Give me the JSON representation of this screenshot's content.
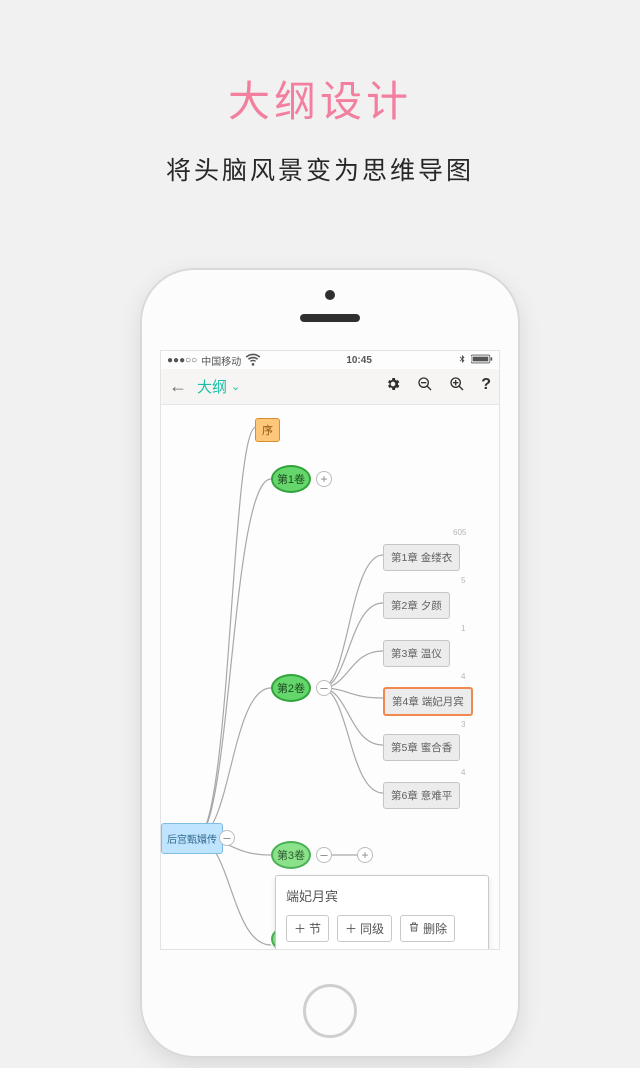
{
  "headline": "大纲设计",
  "subline": "将头脑风景变为思维导图",
  "status": {
    "carrier": "中国移动",
    "time": "10:45",
    "signal": "●●●○○",
    "wifi": "wifi",
    "battery": "batt"
  },
  "toolbar": {
    "outline_label": "大纲"
  },
  "root": {
    "label": "后宫甄嬛传"
  },
  "seq": {
    "label": "序"
  },
  "vol1": {
    "label": "第1卷"
  },
  "vol2": {
    "label": "第2卷"
  },
  "vol3": {
    "label": "第3卷"
  },
  "vol2_count": "605",
  "chapters": [
    {
      "label": "第1章 金缕衣",
      "count": "5"
    },
    {
      "label": "第2章 夕颜",
      "count": "1"
    },
    {
      "label": "第3章 温仪",
      "count": "4"
    },
    {
      "label": "第4章 端妃月宾",
      "count": ""
    },
    {
      "label": "第5章 蜜合香",
      "count": "3"
    },
    {
      "label": "第6章 意难平",
      "count": "4"
    }
  ],
  "popup": {
    "title": "端妃月宾",
    "btn_child": "节",
    "btn_sibling": "同级",
    "btn_delete": "删除"
  }
}
